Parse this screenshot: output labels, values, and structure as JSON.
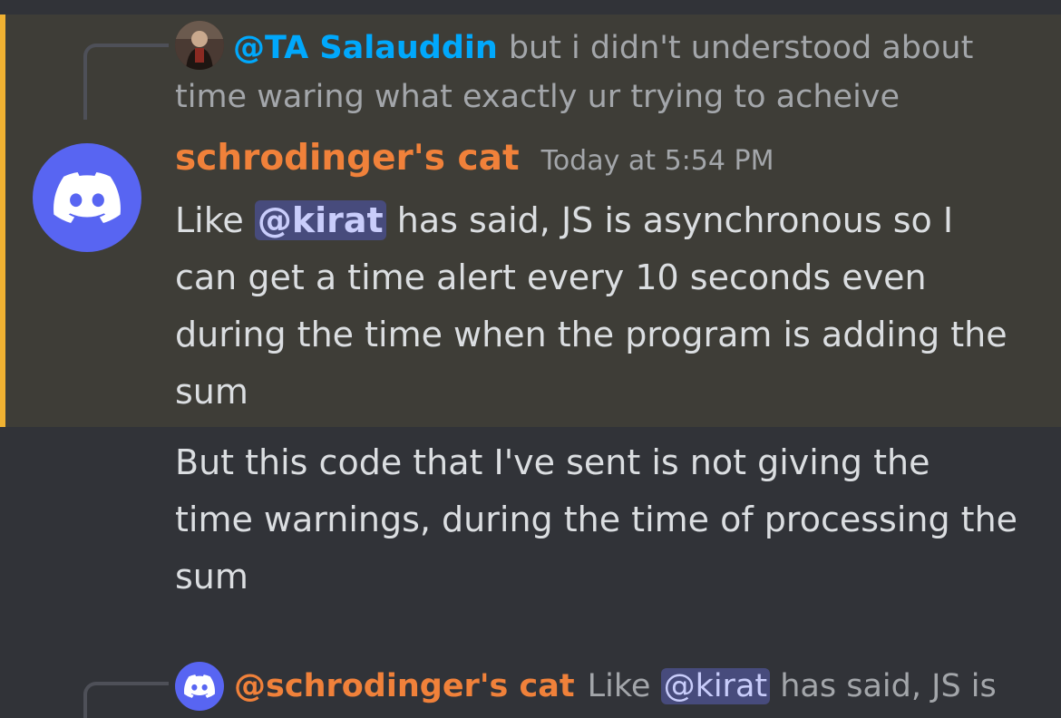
{
  "colors": {
    "background": "#313338",
    "highlight_background": "#3e3d37",
    "highlight_accent": "#f0b232",
    "reply_mention": "#00a8fc",
    "username": "#f0813a",
    "mention_bg": "#474b7c",
    "mention_text": "#c9cdfb",
    "body_text": "#dbdee1",
    "muted_text": "#a3a6aa",
    "avatar_bg": "#5865f2"
  },
  "reply": {
    "author": "@TA Salauddin",
    "text": "but i didn't understood about time waring what exactly ur trying to acheive",
    "avatar_icon": "user-photo-avatar"
  },
  "message": {
    "author": "schrodinger's cat",
    "timestamp": "Today at 5:54 PM",
    "avatar_icon": "discord-logo-icon",
    "line1": {
      "before": "Like ",
      "mention": "@kirat",
      "after": " has said, JS is asynchronous so I can get a time alert every 10 seconds even during the time when the program is adding the sum"
    },
    "line2": "But this code that I've sent is not giving the time warnings, during the time of processing the sum"
  },
  "next_reply": {
    "author": "@schrodinger's cat",
    "before": "Like ",
    "mention": "@kirat",
    "after": " has said, JS is"
  }
}
